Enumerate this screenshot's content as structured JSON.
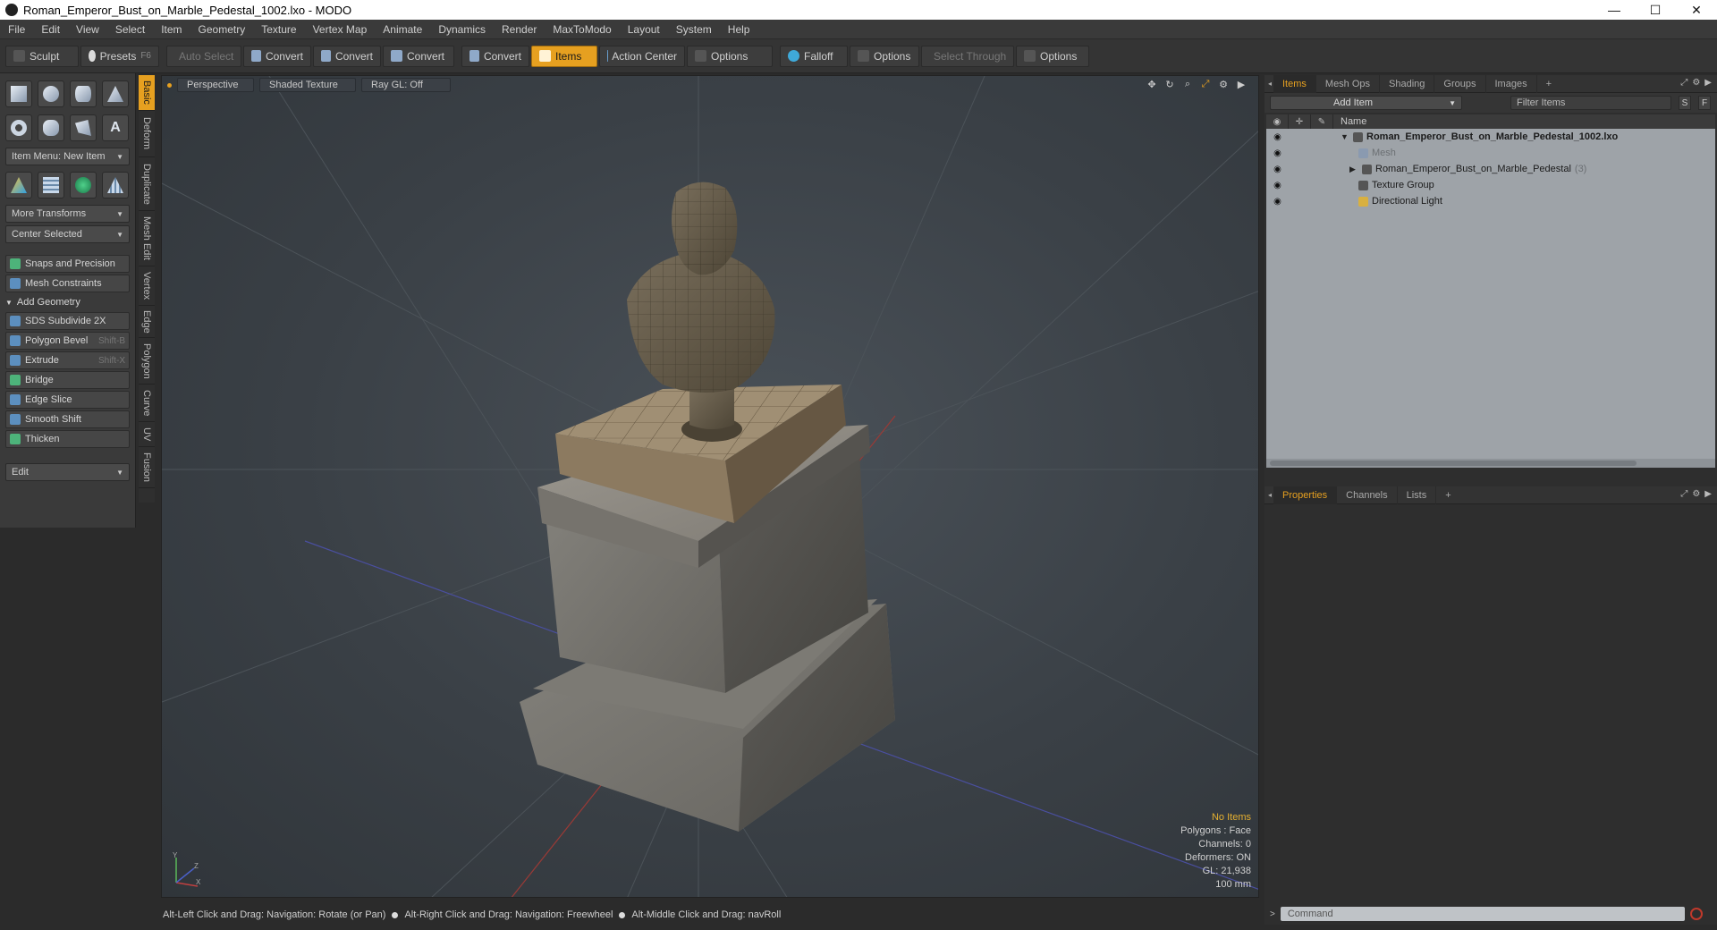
{
  "window": {
    "title": "Roman_Emperor_Bust_on_Marble_Pedestal_1002.lxo - MODO",
    "minimize_glyph": "—",
    "maximize_glyph": "☐",
    "close_glyph": "✕"
  },
  "menu": [
    "File",
    "Edit",
    "View",
    "Select",
    "Item",
    "Geometry",
    "Texture",
    "Vertex Map",
    "Animate",
    "Dynamics",
    "Render",
    "MaxToModo",
    "Layout",
    "System",
    "Help"
  ],
  "toolbar": {
    "sculpt": "Sculpt",
    "presets": "Presets",
    "presets_key": "F6",
    "auto_select": "Auto Select",
    "convert1": "Convert",
    "convert2": "Convert",
    "convert3": "Convert",
    "convert4": "Convert",
    "items": "Items",
    "action_center": "Action Center",
    "options1": "Options",
    "falloff": "Falloff",
    "options2": "Options",
    "select_through": "Select Through",
    "options3": "Options"
  },
  "left": {
    "item_menu": "Item Menu: New Item",
    "more_transforms": "More Transforms",
    "center_selected": "Center Selected",
    "snaps": "Snaps and Precision",
    "mesh_constraints": "Mesh Constraints",
    "add_geometry": "Add Geometry",
    "tools": [
      {
        "label": "SDS Subdivide 2X",
        "key": ""
      },
      {
        "label": "Polygon Bevel",
        "key": "Shift-B"
      },
      {
        "label": "Extrude",
        "key": "Shift-X"
      },
      {
        "label": "Bridge",
        "key": ""
      },
      {
        "label": "Edge Slice",
        "key": ""
      },
      {
        "label": "Smooth Shift",
        "key": ""
      },
      {
        "label": "Thicken",
        "key": ""
      }
    ],
    "edit": "Edit"
  },
  "vtabs": [
    "Basic",
    "Deform",
    "Duplicate",
    "Mesh Edit",
    "Vertex",
    "Edge",
    "Polygon",
    "Curve",
    "UV",
    "Fusion"
  ],
  "viewport": {
    "perspective": "Perspective",
    "shaded": "Shaded Texture",
    "raygl": "Ray GL: Off",
    "stats": {
      "no_items": "No Items",
      "polygons": "Polygons : Face",
      "channels": "Channels: 0",
      "deformers": "Deformers: ON",
      "gl": "GL: 21,938",
      "scale": "100 mm"
    },
    "axis_y": "Y",
    "axis_x": "X",
    "axis_z": "Z"
  },
  "status": {
    "s1": "Alt-Left Click and Drag: Navigation: Rotate (or Pan)",
    "s2": "Alt-Right Click and Drag: Navigation: Freewheel",
    "s3": "Alt-Middle Click and Drag: navRoll"
  },
  "items_panel": {
    "tabs": [
      "Items",
      "Mesh Ops",
      "Shading",
      "Groups",
      "Images"
    ],
    "add_item": "Add Item",
    "filter_placeholder": "Filter Items",
    "s_btn": "S",
    "f_btn": "F",
    "name_header": "Name",
    "rows": [
      {
        "label": "Roman_Emperor_Bust_on_Marble_Pedestal_1002.lxo",
        "count": ""
      },
      {
        "label": "Mesh",
        "count": ""
      },
      {
        "label": "Roman_Emperor_Bust_on_Marble_Pedestal",
        "count": "(3)"
      },
      {
        "label": "Texture Group",
        "count": ""
      },
      {
        "label": "Directional Light",
        "count": ""
      }
    ]
  },
  "props_panel": {
    "tabs": [
      "Properties",
      "Channels",
      "Lists"
    ]
  },
  "command": {
    "placeholder": "Command"
  },
  "colors": {
    "accent": "#e6a020",
    "viewport_bg": "#3a4046"
  }
}
